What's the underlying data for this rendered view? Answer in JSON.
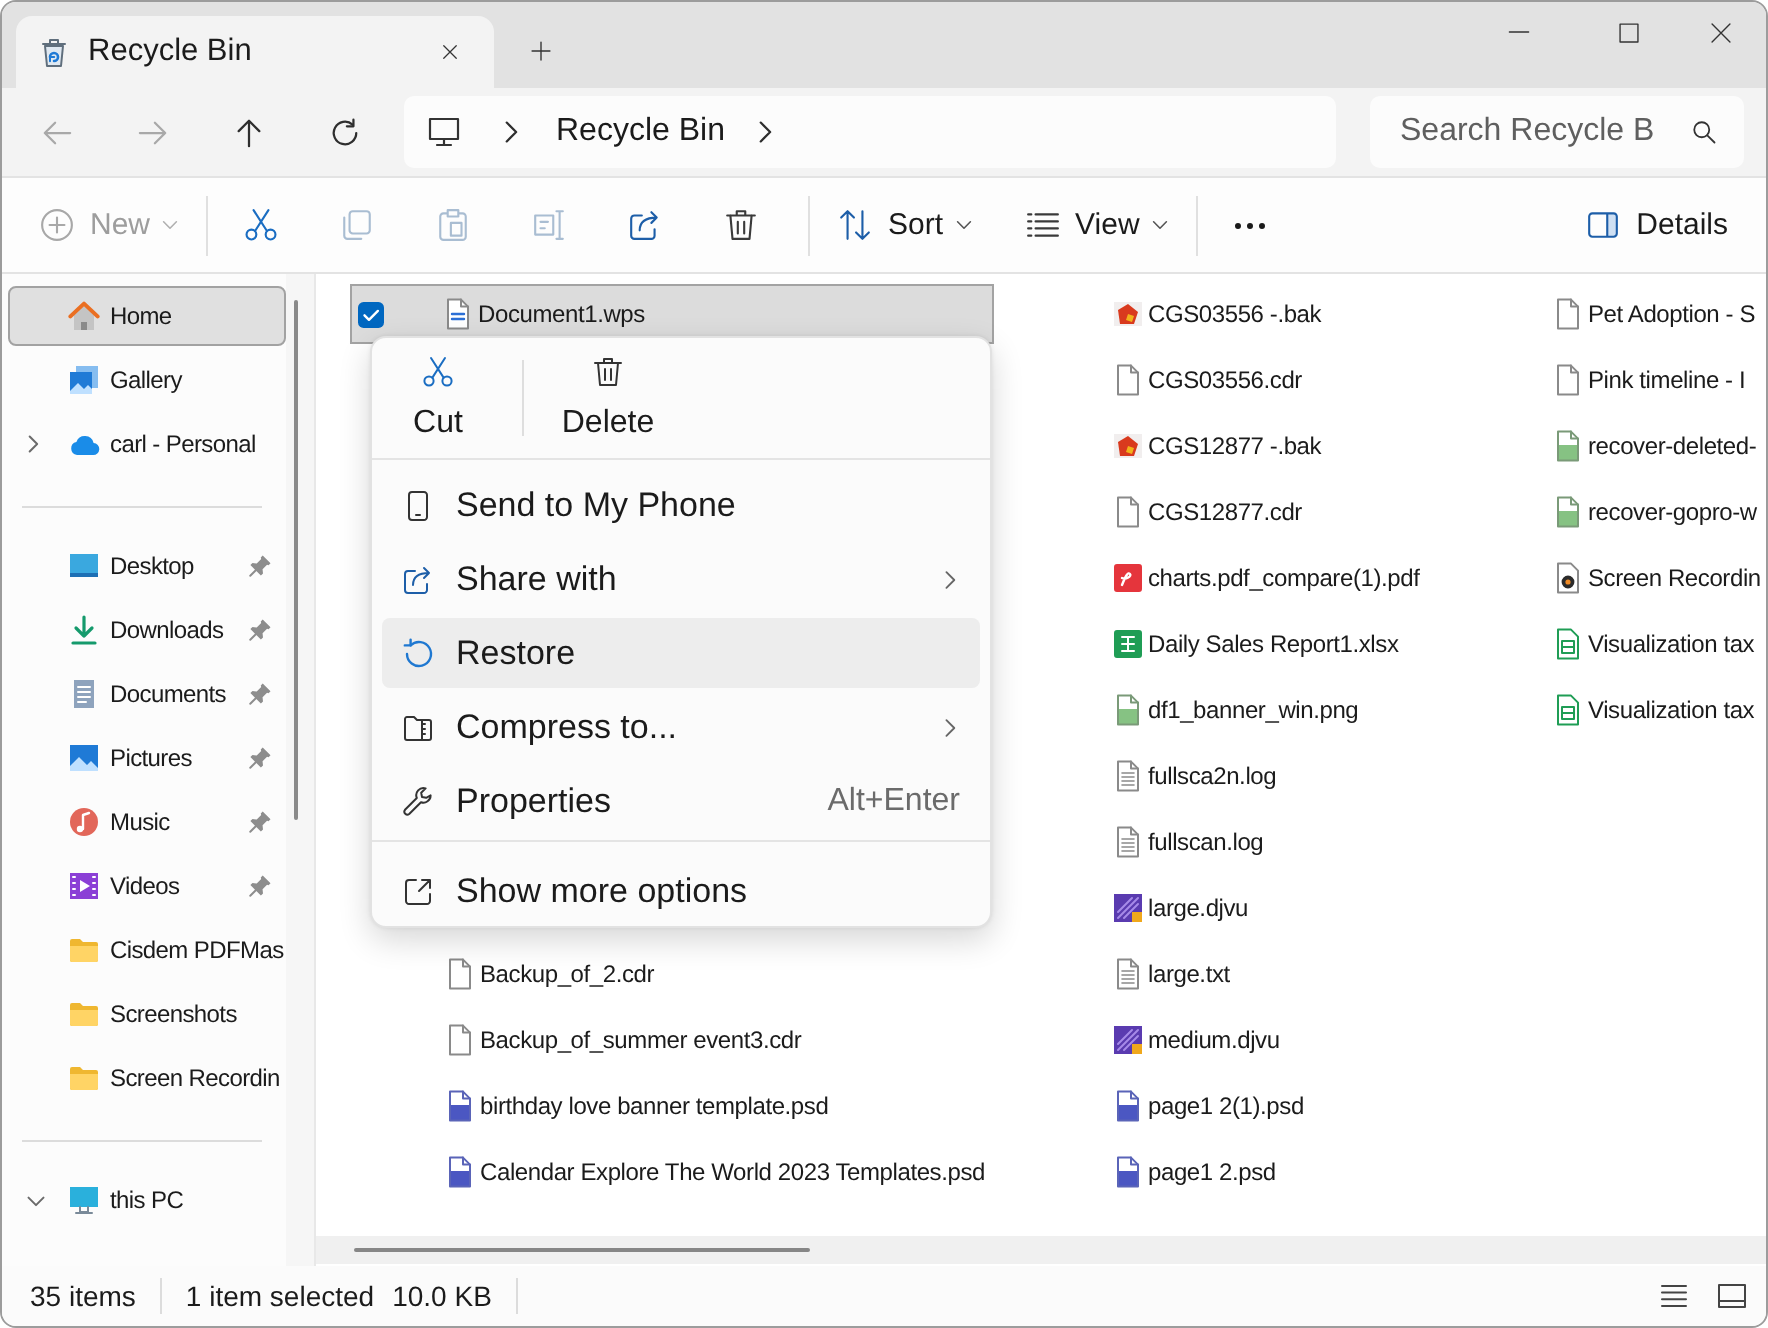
{
  "tabs": [
    {
      "label": "Recycle Bin",
      "selected": true
    }
  ],
  "navigation": [
    {
      "kind": "back",
      "disabled": true
    },
    {
      "kind": "forward",
      "disabled": true
    },
    {
      "kind": "up",
      "disabled": false
    },
    {
      "kind": "refresh",
      "disabled": false
    }
  ],
  "address_bar": {
    "path": [
      "Recycle Bin"
    ]
  },
  "search": {
    "placeholder": "Search Recycle B"
  },
  "toolbar": {
    "groups": [
      [
        {
          "kind": "new",
          "label": "New",
          "disabled": true,
          "dropdown": true
        }
      ],
      [
        {
          "kind": "cut",
          "disabled": false,
          "dropdown": false
        },
        {
          "kind": "copy",
          "disabled": true,
          "dropdown": false
        },
        {
          "kind": "paste",
          "disabled": true,
          "dropdown": false
        },
        {
          "kind": "rename",
          "disabled": true,
          "dropdown": false
        },
        {
          "kind": "share",
          "disabled": false,
          "dropdown": false
        },
        {
          "kind": "delete",
          "disabled": false,
          "dropdown": false
        }
      ],
      [
        {
          "kind": "sort",
          "label": "Sort",
          "disabled": false,
          "dropdown": true
        },
        {
          "kind": "view",
          "label": "View",
          "disabled": false,
          "dropdown": true
        }
      ],
      [
        {
          "kind": "more",
          "disabled": false,
          "dropdown": false
        }
      ]
    ],
    "details": {
      "label": "Details"
    }
  },
  "sidebar": {
    "groups": [
      {
        "items": [
          {
            "kind": "home",
            "label": "Home",
            "selected": true,
            "pinned": false
          },
          {
            "kind": "gallery",
            "label": "Gallery",
            "selected": false,
            "pinned": false
          },
          {
            "kind": "cloud",
            "label": "carl - Personal",
            "selected": false,
            "pinned": false,
            "expanded": false
          }
        ]
      },
      {
        "items": [
          {
            "kind": "desktop",
            "label": "Desktop",
            "selected": false,
            "pinned": true
          },
          {
            "kind": "downloads",
            "label": "Downloads",
            "selected": false,
            "pinned": true
          },
          {
            "kind": "documents",
            "label": "Documents",
            "selected": false,
            "pinned": true
          },
          {
            "kind": "pictures",
            "label": "Pictures",
            "selected": false,
            "pinned": true
          },
          {
            "kind": "music",
            "label": "Music",
            "selected": false,
            "pinned": true
          },
          {
            "kind": "videos",
            "label": "Videos",
            "selected": false,
            "pinned": true
          },
          {
            "kind": "folder",
            "label": "Cisdem PDFMas",
            "selected": false,
            "pinned": false
          },
          {
            "kind": "folder",
            "label": "Screenshots",
            "selected": false,
            "pinned": false
          },
          {
            "kind": "folder",
            "label": "Screen Recordin",
            "selected": false,
            "pinned": false
          }
        ]
      },
      {
        "items": [
          {
            "kind": "pc",
            "label": "this PC",
            "selected": false,
            "pinned": false,
            "expanded": true
          }
        ]
      }
    ]
  },
  "file_list": {
    "columns": [
      {
        "items_top": [
          {
            "kind": "document",
            "name": "Document1.wps",
            "selected": true
          }
        ],
        "items_bottom": [
          {
            "kind": "blank",
            "name": "Backup_of_2.cdr",
            "selected": false
          },
          {
            "kind": "blank",
            "name": "Backup_of_summer event3.cdr",
            "selected": false
          },
          {
            "kind": "psd",
            "name": "birthday love banner template.psd",
            "selected": false
          },
          {
            "kind": "psd",
            "name": "Calendar Explore The World 2023 Templates.psd",
            "selected": false
          }
        ]
      },
      {
        "items_top": [
          {
            "kind": "bak",
            "name": "CGS03556 -.bak",
            "selected": false
          },
          {
            "kind": "blank",
            "name": "CGS03556.cdr",
            "selected": false
          },
          {
            "kind": "bak",
            "name": "CGS12877 -.bak",
            "selected": false
          },
          {
            "kind": "blank",
            "name": "CGS12877.cdr",
            "selected": false
          },
          {
            "kind": "pdf",
            "name": "charts.pdf_compare(1).pdf",
            "selected": false
          },
          {
            "kind": "sheet",
            "name": "Daily Sales Report1.xlsx",
            "selected": false
          },
          {
            "kind": "png",
            "name": "df1_banner_win.png",
            "selected": false
          },
          {
            "kind": "text",
            "name": "fullsca2n.log",
            "selected": false
          },
          {
            "kind": "text",
            "name": "fullscan.log",
            "selected": false
          },
          {
            "kind": "djvu",
            "name": "large.djvu",
            "selected": false
          },
          {
            "kind": "text",
            "name": "large.txt",
            "selected": false
          },
          {
            "kind": "djvu",
            "name": "medium.djvu",
            "selected": false
          },
          {
            "kind": "psd",
            "name": "page1 2(1).psd",
            "selected": false
          },
          {
            "kind": "psd",
            "name": "page1 2.psd",
            "selected": false
          }
        ]
      },
      {
        "items_top": [
          {
            "kind": "blank",
            "name": "Pet Adoption - S",
            "selected": false
          },
          {
            "kind": "blank",
            "name": "Pink timeline - I",
            "selected": false
          },
          {
            "kind": "png",
            "name": "recover-deleted-",
            "selected": false
          },
          {
            "kind": "png",
            "name": "recover-gopro-w",
            "selected": false
          },
          {
            "kind": "video",
            "name": "Screen Recordin",
            "selected": false
          },
          {
            "kind": "sheet2",
            "name": "Visualization tax",
            "selected": false
          },
          {
            "kind": "sheet2",
            "name": "Visualization tax",
            "selected": false
          }
        ]
      }
    ]
  },
  "context_menu": {
    "quick_actions": [
      {
        "kind": "cut",
        "label": "Cut"
      },
      {
        "kind": "delete",
        "label": "Delete"
      }
    ],
    "groups": [
      {
        "items": [
          {
            "kind": "phone",
            "label": "Send to My Phone",
            "selected": false,
            "submenu": false
          },
          {
            "kind": "share",
            "label": "Share with",
            "selected": false,
            "submenu": true
          },
          {
            "kind": "restore",
            "label": "Restore",
            "selected": true,
            "submenu": false
          },
          {
            "kind": "compress",
            "label": "Compress to...",
            "selected": false,
            "submenu": true
          },
          {
            "kind": "properties",
            "label": "Properties",
            "selected": false,
            "submenu": false,
            "shortcut": "Alt+Enter"
          }
        ]
      },
      {
        "items": [
          {
            "kind": "more",
            "label": "Show more options",
            "selected": false,
            "submenu": false
          }
        ]
      }
    ]
  },
  "status_bar": {
    "item_count": "35 items",
    "selection": "1 item selected",
    "size": "10.0 KB"
  }
}
